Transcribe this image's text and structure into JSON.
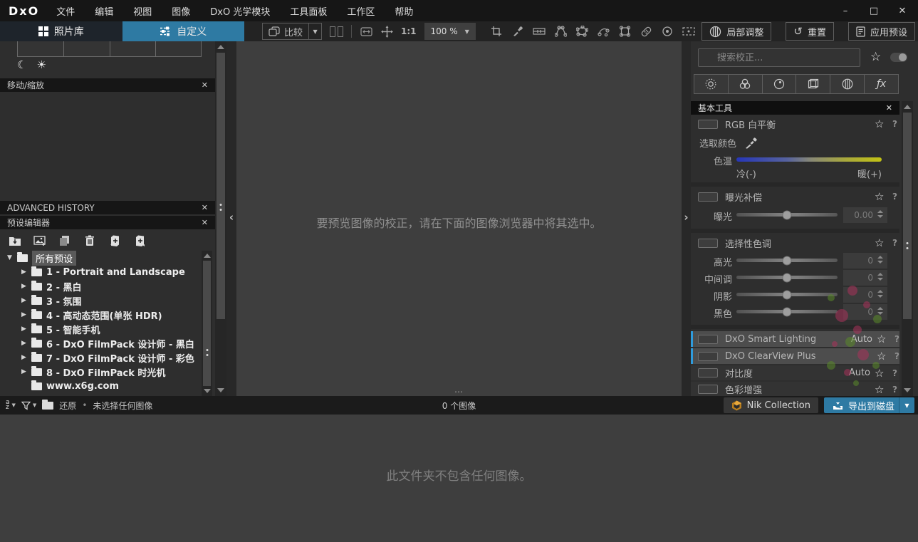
{
  "window": {
    "logo": "DxO",
    "minimize": "–",
    "maximize": "□",
    "close": "✕"
  },
  "menu_items": [
    "文件",
    "编辑",
    "视图",
    "图像",
    "DxO 光学模块",
    "工具面板",
    "工作区",
    "帮助"
  ],
  "tabs": {
    "library": "照片库",
    "customize": "自定义"
  },
  "toolbar": {
    "compare": "比较",
    "ratio": "1:1",
    "zoom_level": "100 %",
    "local_adjustments": "局部调整",
    "reset": "重置",
    "apply_preset": "应用预设"
  },
  "icons": {
    "close": "✕",
    "star": "☆",
    "help": "?",
    "dropdown": "▼",
    "tree_expanded": "▼",
    "tree_collapsed": "▶",
    "moon": "☾",
    "sun": "☀",
    "ellipsis": "⋯",
    "bullet": "•",
    "chevron_left": "‹",
    "chevron_right": "›",
    "fx": "ƒx",
    "reset_arrow": "↺",
    "sort_a": "a",
    "sort_z": "z"
  },
  "left_panel": {
    "move_zoom_title": "移动/缩放",
    "history_title": "ADVANCED HISTORY",
    "preset_editor_title": "预设编辑器",
    "presets": [
      {
        "label": "所有预设"
      },
      {
        "label": "1 - Portrait and Landscape"
      },
      {
        "label": "2 - 黑白"
      },
      {
        "label": "3 - 氛围"
      },
      {
        "label": "4 - 高动态范围(单张 HDR)"
      },
      {
        "label": "5 - 智能手机"
      },
      {
        "label": "6 - DxO FilmPack 设计师 - 黑白"
      },
      {
        "label": "7 - DxO FilmPack 设计师 - 彩色"
      },
      {
        "label": "8 - DxO FilmPack 时光机"
      },
      {
        "label": "www.x6g.com"
      }
    ]
  },
  "viewer": {
    "empty_message": "要预览图像的校正，请在下面的图像浏览器中将其选中。"
  },
  "right_panel": {
    "search_placeholder": "搜索校正...",
    "basic_tools_title": "基本工具",
    "white_balance": {
      "title": "RGB 白平衡",
      "pick_color_label": "选取颜色",
      "temperature_label": "色温",
      "cold_label": "冷(-)",
      "warm_label": "暖(+)"
    },
    "exposure": {
      "title": "曝光补偿",
      "slider_label": "曝光",
      "value": "0.00"
    },
    "selective_tone": {
      "title": "选择性色调",
      "sliders": [
        {
          "label": "高光",
          "value": "0"
        },
        {
          "label": "中间调",
          "value": "0"
        },
        {
          "label": "阴影",
          "value": "0"
        },
        {
          "label": "黑色",
          "value": "0"
        }
      ]
    },
    "smart_lighting": {
      "title": "DxO Smart Lighting",
      "mode": "Auto"
    },
    "clearview": {
      "title": "DxO ClearView Plus"
    },
    "contrast": {
      "title": "对比度",
      "mode": "Auto"
    },
    "color_enhance": {
      "title": "色彩增强"
    }
  },
  "status_bar": {
    "restore_label": "还原",
    "selection_status": "未选择任何图像",
    "image_count": "0 个图像",
    "nik_label": "Nik Collection",
    "export_label": "导出到磁盘"
  },
  "browser": {
    "empty_message": "此文件夹不包含任何图像。"
  },
  "colors": {
    "accent_blue": "#2e7aa3",
    "indicator_blue": "#2f9bdc",
    "temp_cold": "#2636b8",
    "temp_warm": "#c2c214"
  }
}
